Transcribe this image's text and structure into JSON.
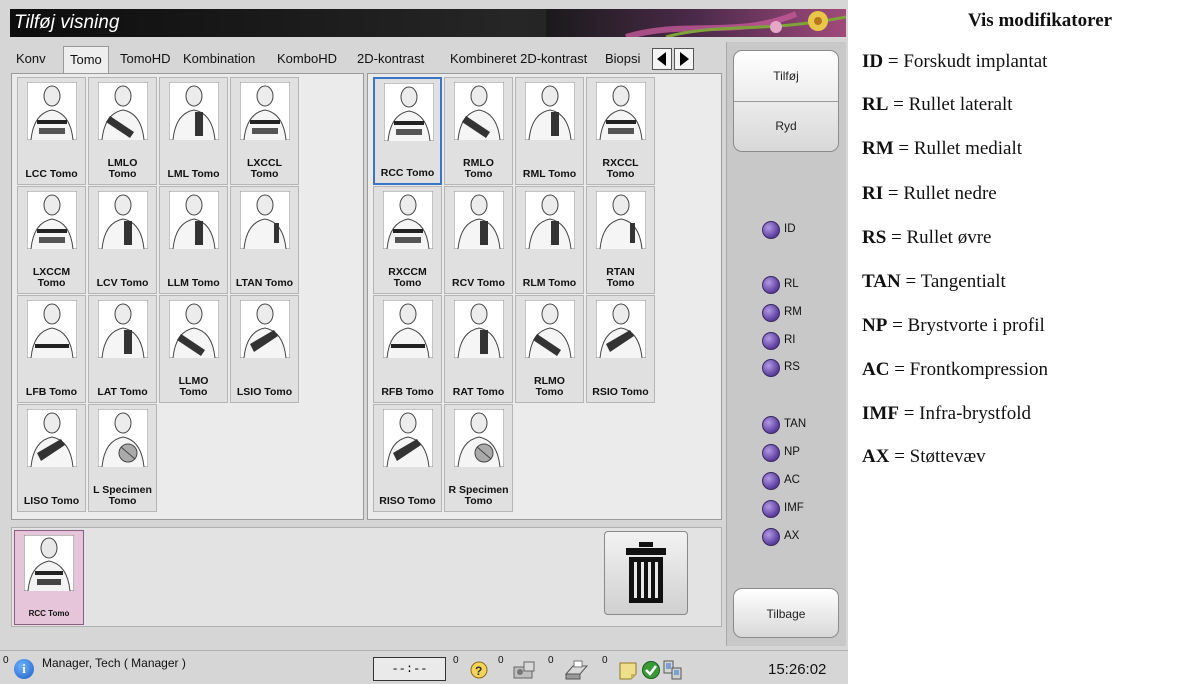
{
  "window": {
    "title": "Tilføj visning"
  },
  "tabs": [
    {
      "label": "Konv",
      "active": false
    },
    {
      "label": "Tomo",
      "active": true
    },
    {
      "label": "TomoHD",
      "active": false
    },
    {
      "label": "Kombination",
      "active": false
    },
    {
      "label": "KomboHD",
      "active": false
    },
    {
      "label": "2D-kontrast",
      "active": false
    },
    {
      "label": "Kombineret 2D-kontrast",
      "active": false
    },
    {
      "label": "Biopsi",
      "active": false
    }
  ],
  "left_views": [
    {
      "label": "LCC Tomo",
      "icon": "breast-cc-view-icon"
    },
    {
      "label": "LMLO\nTomo",
      "icon": "breast-mlo-view-icon"
    },
    {
      "label": "LML Tomo",
      "icon": "breast-ml-view-icon"
    },
    {
      "label": "LXCCL\nTomo",
      "icon": "breast-xccl-view-icon"
    },
    {
      "label": "LXCCM\nTomo",
      "icon": "breast-xccm-view-icon"
    },
    {
      "label": "LCV Tomo",
      "icon": "breast-cv-view-icon"
    },
    {
      "label": "LLM Tomo",
      "icon": "breast-lm-view-icon"
    },
    {
      "label": "LTAN Tomo",
      "icon": "breast-tan-view-icon"
    },
    {
      "label": "LFB Tomo",
      "icon": "breast-fb-view-icon"
    },
    {
      "label": "LAT Tomo",
      "icon": "breast-at-view-icon"
    },
    {
      "label": "LLMO\nTomo",
      "icon": "breast-lmo-view-icon"
    },
    {
      "label": "LSIO Tomo",
      "icon": "breast-sio-view-icon"
    },
    {
      "label": "LISO Tomo",
      "icon": "breast-iso-view-icon"
    },
    {
      "label": "L Specimen\nTomo",
      "icon": "specimen-view-icon"
    }
  ],
  "right_views": [
    {
      "label": "RCC Tomo",
      "icon": "breast-cc-view-icon"
    },
    {
      "label": "RMLO\nTomo",
      "icon": "breast-mlo-view-icon"
    },
    {
      "label": "RML Tomo",
      "icon": "breast-ml-view-icon"
    },
    {
      "label": "RXCCL\nTomo",
      "icon": "breast-xccl-view-icon"
    },
    {
      "label": "RXCCM\nTomo",
      "icon": "breast-xccm-view-icon"
    },
    {
      "label": "RCV Tomo",
      "icon": "breast-cv-view-icon"
    },
    {
      "label": "RLM Tomo",
      "icon": "breast-lm-view-icon"
    },
    {
      "label": "RTAN\nTomo",
      "icon": "breast-tan-view-icon"
    },
    {
      "label": "RFB Tomo",
      "icon": "breast-fb-view-icon"
    },
    {
      "label": "RAT Tomo",
      "icon": "breast-at-view-icon"
    },
    {
      "label": "RLMO\nTomo",
      "icon": "breast-lmo-view-icon"
    },
    {
      "label": "RSIO Tomo",
      "icon": "breast-sio-view-icon"
    },
    {
      "label": "RISO Tomo",
      "icon": "breast-iso-view-icon"
    },
    {
      "label": "R Specimen\nTomo",
      "icon": "specimen-view-icon"
    }
  ],
  "selected_view": {
    "label": "RCC Tomo"
  },
  "sidebar": {
    "add_label": "Tilføj",
    "clear_label": "Ryd",
    "back_label": "Tilbage"
  },
  "modifiers": [
    "ID",
    "RL",
    "RM",
    "RI",
    "RS",
    "TAN",
    "NP",
    "AC",
    "IMF",
    "AX"
  ],
  "status": {
    "user_count": "0",
    "user": "Manager, Tech ( Manager )",
    "timer": "--:--",
    "counts": [
      "0",
      "0",
      "0",
      "0"
    ],
    "time": "15:26:02"
  },
  "legend": {
    "title": "Vis modifikatorer",
    "rows": [
      {
        "code": "ID",
        "desc": " = Forskudt implantat"
      },
      {
        "code": "RL",
        "desc": " = Rullet lateralt"
      },
      {
        "code": "RM",
        "desc": " = Rullet medialt"
      },
      {
        "code": "RI",
        "desc": " = Rullet nedre"
      },
      {
        "code": "RS",
        "desc": " = Rullet øvre"
      },
      {
        "code": "TAN",
        "desc": " = Tangentialt"
      },
      {
        "code": "NP",
        "desc": " = Brystvorte i profil"
      },
      {
        "code": "AC",
        "desc": " = Frontkompression"
      },
      {
        "code": "IMF",
        "desc": " = Infra-brystfold"
      },
      {
        "code": "AX",
        "desc": " = Støttevæv"
      }
    ]
  },
  "colors": {
    "selected_border": "#3c74c8",
    "selected_tile": "#e6c5da",
    "modifier_dot": "#6b4aa8"
  }
}
